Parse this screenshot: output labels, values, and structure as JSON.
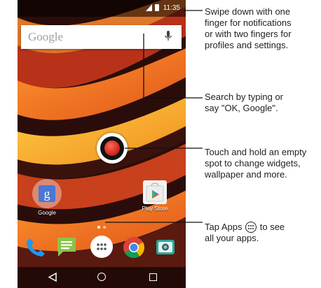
{
  "status_bar": {
    "time": "11:35"
  },
  "search": {
    "logo_text": "Google"
  },
  "home": {
    "apps": [
      {
        "label": "Google",
        "icon_letter": "g"
      },
      {
        "label": "Play Store"
      }
    ],
    "dock": [
      "phone-icon",
      "messages-icon",
      "apps-icon",
      "chrome-icon",
      "camera-icon"
    ],
    "page_indicator": {
      "count": 2,
      "active": 1
    }
  },
  "nav": [
    "back-icon",
    "home-icon",
    "recents-icon"
  ],
  "callouts": {
    "notifications": [
      "Swipe down with one",
      "finger for notifications",
      "or with two fingers for",
      "profiles and settings."
    ],
    "search": [
      "Search by typing or",
      "say \"OK, Google\"."
    ],
    "widgets": [
      "Touch and hold an empty",
      "spot to change widgets,",
      "wallpaper and more."
    ],
    "apps_prefix": "Tap Apps",
    "apps_suffix": "to see",
    "apps_line2": "all your apps."
  },
  "colors": {
    "touch_indicator": "#d42a1e",
    "search_bar": "#ffffff",
    "google_tile": "#4a77d4",
    "chrome_red": "#db4437",
    "chrome_yellow": "#f4b400",
    "chrome_green": "#0f9d58",
    "chrome_blue": "#4285f4"
  }
}
